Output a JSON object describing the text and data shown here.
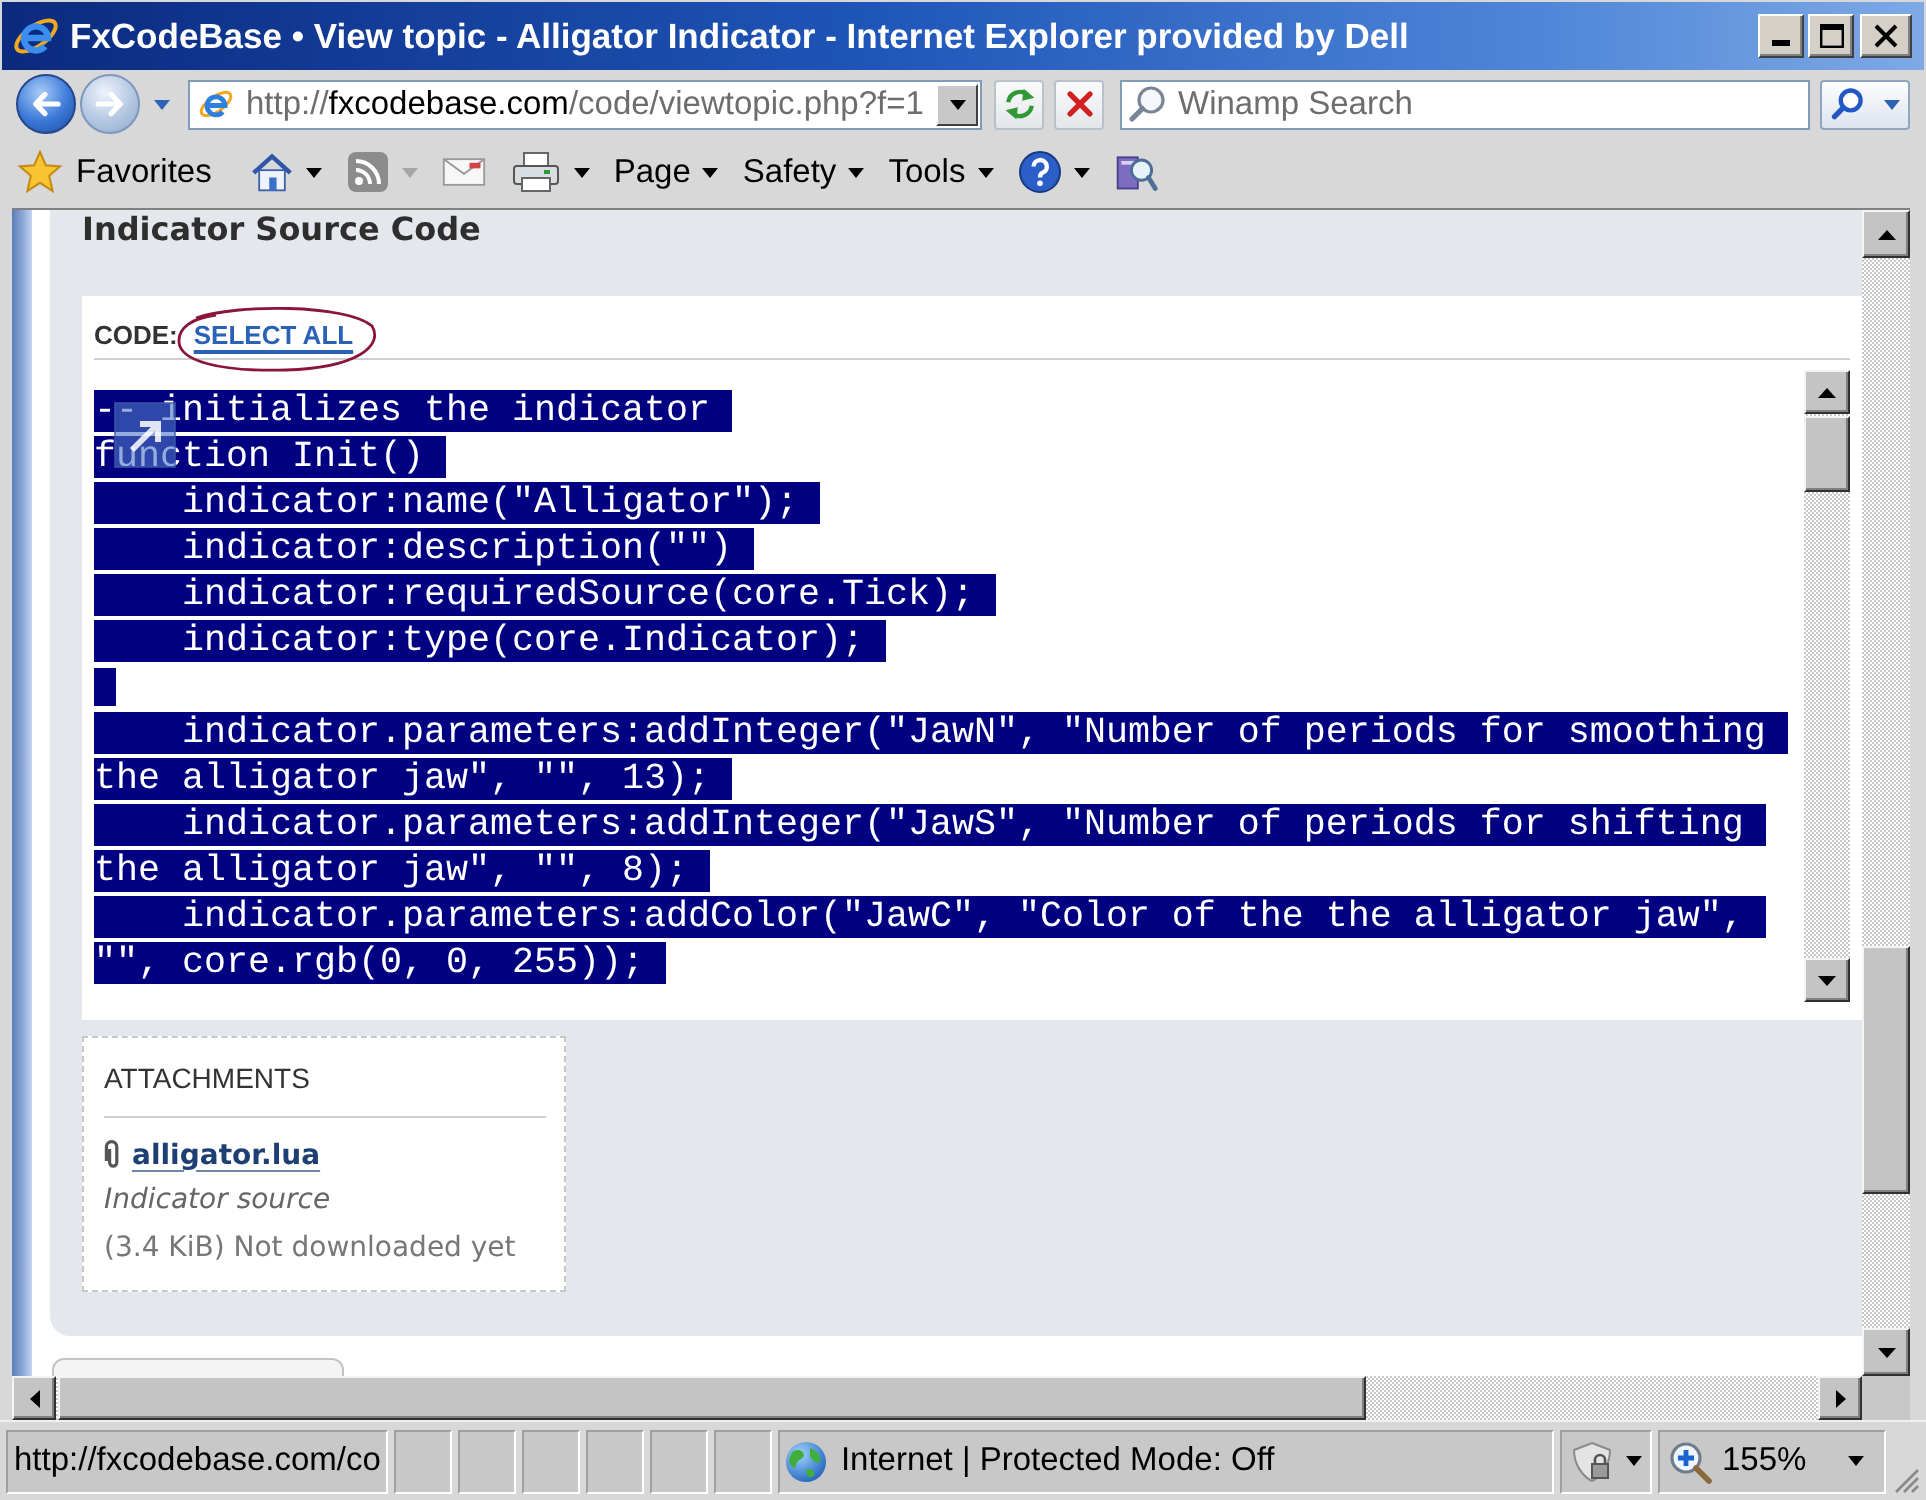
{
  "window": {
    "title": "FxCodeBase • View topic - Alligator Indicator - Internet Explorer provided by Dell"
  },
  "navigation": [
    {
      "kind": "back",
      "disabled": false
    },
    {
      "kind": "forward",
      "disabled": true
    }
  ],
  "address_bar": {
    "scheme": "http://",
    "domain": "fxcodebase.com",
    "path": "/code/viewtopic.php?f=1"
  },
  "search": {
    "placeholder": "Winamp Search"
  },
  "command_bar": [
    {
      "kind": "favorites",
      "label": "Favorites",
      "dropdown": false,
      "disabled": false
    },
    {
      "kind": "home",
      "dropdown": true,
      "disabled": false
    },
    {
      "kind": "feeds",
      "dropdown": true,
      "disabled": true
    },
    {
      "kind": "mail",
      "dropdown": false,
      "disabled": false
    },
    {
      "kind": "print",
      "dropdown": true,
      "disabled": false
    },
    {
      "kind": "menu",
      "label": "Page",
      "dropdown": true,
      "disabled": false
    },
    {
      "kind": "menu",
      "label": "Safety",
      "dropdown": true,
      "disabled": false
    },
    {
      "kind": "menu",
      "label": "Tools",
      "dropdown": true,
      "disabled": false
    },
    {
      "kind": "help",
      "dropdown": true,
      "disabled": false
    },
    {
      "kind": "research",
      "dropdown": false,
      "disabled": false
    }
  ],
  "page": {
    "heading": "Indicator Source Code",
    "code_box": {
      "label": "CODE:",
      "select_all": {
        "label": "SELECT ALL",
        "circled": true
      },
      "lines": [
        {
          "kind": "code",
          "text": "-- initializes the indicator",
          "selected": true
        },
        {
          "kind": "code",
          "text": "function Init()",
          "selected": true
        },
        {
          "kind": "code",
          "text": "    indicator:name(\"Alligator\");",
          "selected": true
        },
        {
          "kind": "code",
          "text": "    indicator:description(\"\")",
          "selected": true
        },
        {
          "kind": "code",
          "text": "    indicator:requiredSource(core.Tick);",
          "selected": true
        },
        {
          "kind": "code",
          "text": "    indicator:type(core.Indicator);",
          "selected": true
        },
        {
          "kind": "blank",
          "selected": true
        },
        {
          "kind": "code",
          "text": "    indicator.parameters:addInteger(\"JawN\", \"Number of periods for smoothing",
          "selected": true
        },
        {
          "kind": "code",
          "text": "the alligator jaw\", \"\", 13);",
          "selected": true
        },
        {
          "kind": "code",
          "text": "    indicator.parameters:addInteger(\"JawS\", \"Number of periods for shifting",
          "selected": true
        },
        {
          "kind": "code",
          "text": "the alligator jaw\", \"\", 8);",
          "selected": true
        },
        {
          "kind": "code",
          "text": "    indicator.parameters:addColor(\"JawC\", \"Color of the the alligator jaw\",",
          "selected": true
        },
        {
          "kind": "code",
          "text": "\"\", core.rgb(0, 0, 255));",
          "selected": true
        }
      ]
    },
    "attachments": {
      "title": "ATTACHMENTS",
      "files": [
        {
          "name": "alligator.lua",
          "comment": "Indicator source",
          "info": "(3.4 KiB) Not downloaded yet"
        }
      ]
    }
  },
  "status_bar": {
    "url": "http://fxcodebase.com/co",
    "zone": "Internet | Protected Mode: Off",
    "zoom": "155%"
  }
}
